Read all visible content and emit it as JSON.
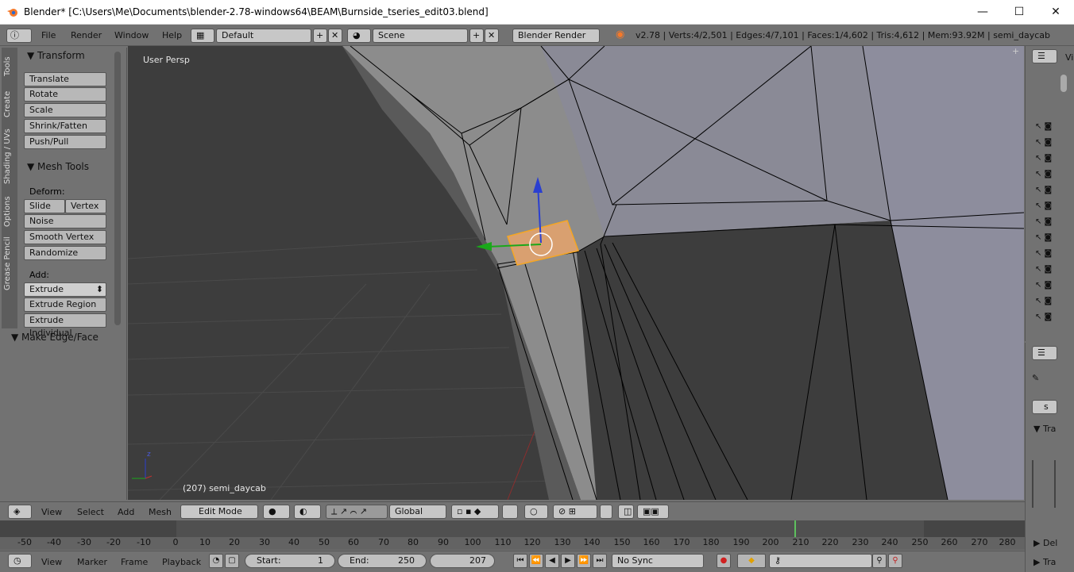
{
  "window": {
    "title": "Blender* [C:\\Users\\Me\\Documents\\blender-2.78-windows64\\BEAM\\Burnside_tseries_edit03.blend]",
    "minimize": "—",
    "maximize": "☐",
    "close": "✕"
  },
  "info_header": {
    "menus": [
      "File",
      "Render",
      "Window",
      "Help"
    ],
    "screen_layout": "Default",
    "scene": "Scene",
    "render_engine": "Blender Render",
    "stats": "v2.78 | Verts:4/2,501 | Edges:4/7,101 | Faces:1/4,602 | Tris:4,612 | Mem:93.92M | semi_daycab"
  },
  "left_tabs": [
    "Tools",
    "Create",
    "Shading / UVs",
    "Options",
    "Grease Pencil"
  ],
  "tool_shelf": {
    "transform": {
      "title": "Transform",
      "buttons": [
        "Translate",
        "Rotate",
        "Scale",
        "Shrink/Fatten",
        "Push/Pull"
      ]
    },
    "mesh_tools": {
      "title": "Mesh Tools",
      "deform_label": "Deform:",
      "slide_edge": "Slide Ed",
      "vertex": "Vertex",
      "noise": "Noise",
      "smooth_vertex": "Smooth Vertex",
      "randomize": "Randomize",
      "add_label": "Add:",
      "extrude": "Extrude",
      "extrude_region": "Extrude Region",
      "extrude_individual": "Extrude Individual"
    },
    "make_edge_face": {
      "title": "Make Edge/Face"
    }
  },
  "viewport": {
    "view_label": "User Persp",
    "object_label": "(207) semi_daycab",
    "axis_z": "z"
  },
  "viewport_header": {
    "menus": [
      "View",
      "Select",
      "Add",
      "Mesh"
    ],
    "mode": "Edit Mode",
    "orientation": "Global"
  },
  "timeline_ruler": {
    "ticks": [
      "-50",
      "-40",
      "-30",
      "-20",
      "-10",
      "0",
      "10",
      "20",
      "30",
      "40",
      "50",
      "60",
      "70",
      "80",
      "90",
      "100",
      "110",
      "120",
      "130",
      "140",
      "150",
      "160",
      "170",
      "180",
      "190",
      "200",
      "210",
      "220",
      "230",
      "240",
      "250",
      "260",
      "270",
      "280"
    ],
    "current_frame": 207
  },
  "timeline_header": {
    "menus": [
      "View",
      "Marker",
      "Frame",
      "Playback"
    ],
    "start": "Start:",
    "start_value": "1",
    "end": "End:",
    "end_value": "250",
    "current": "207",
    "sync": "No Sync"
  },
  "right_panel": {
    "top_label": "Vi",
    "bottom_labels": [
      "Tra",
      "Del",
      "Tra"
    ],
    "s_button": "s"
  },
  "colors": {
    "accent": "#f5a623",
    "selection": "#d9a070",
    "mesh_face": "#8a8a8a",
    "background": "#3d3d3d"
  }
}
